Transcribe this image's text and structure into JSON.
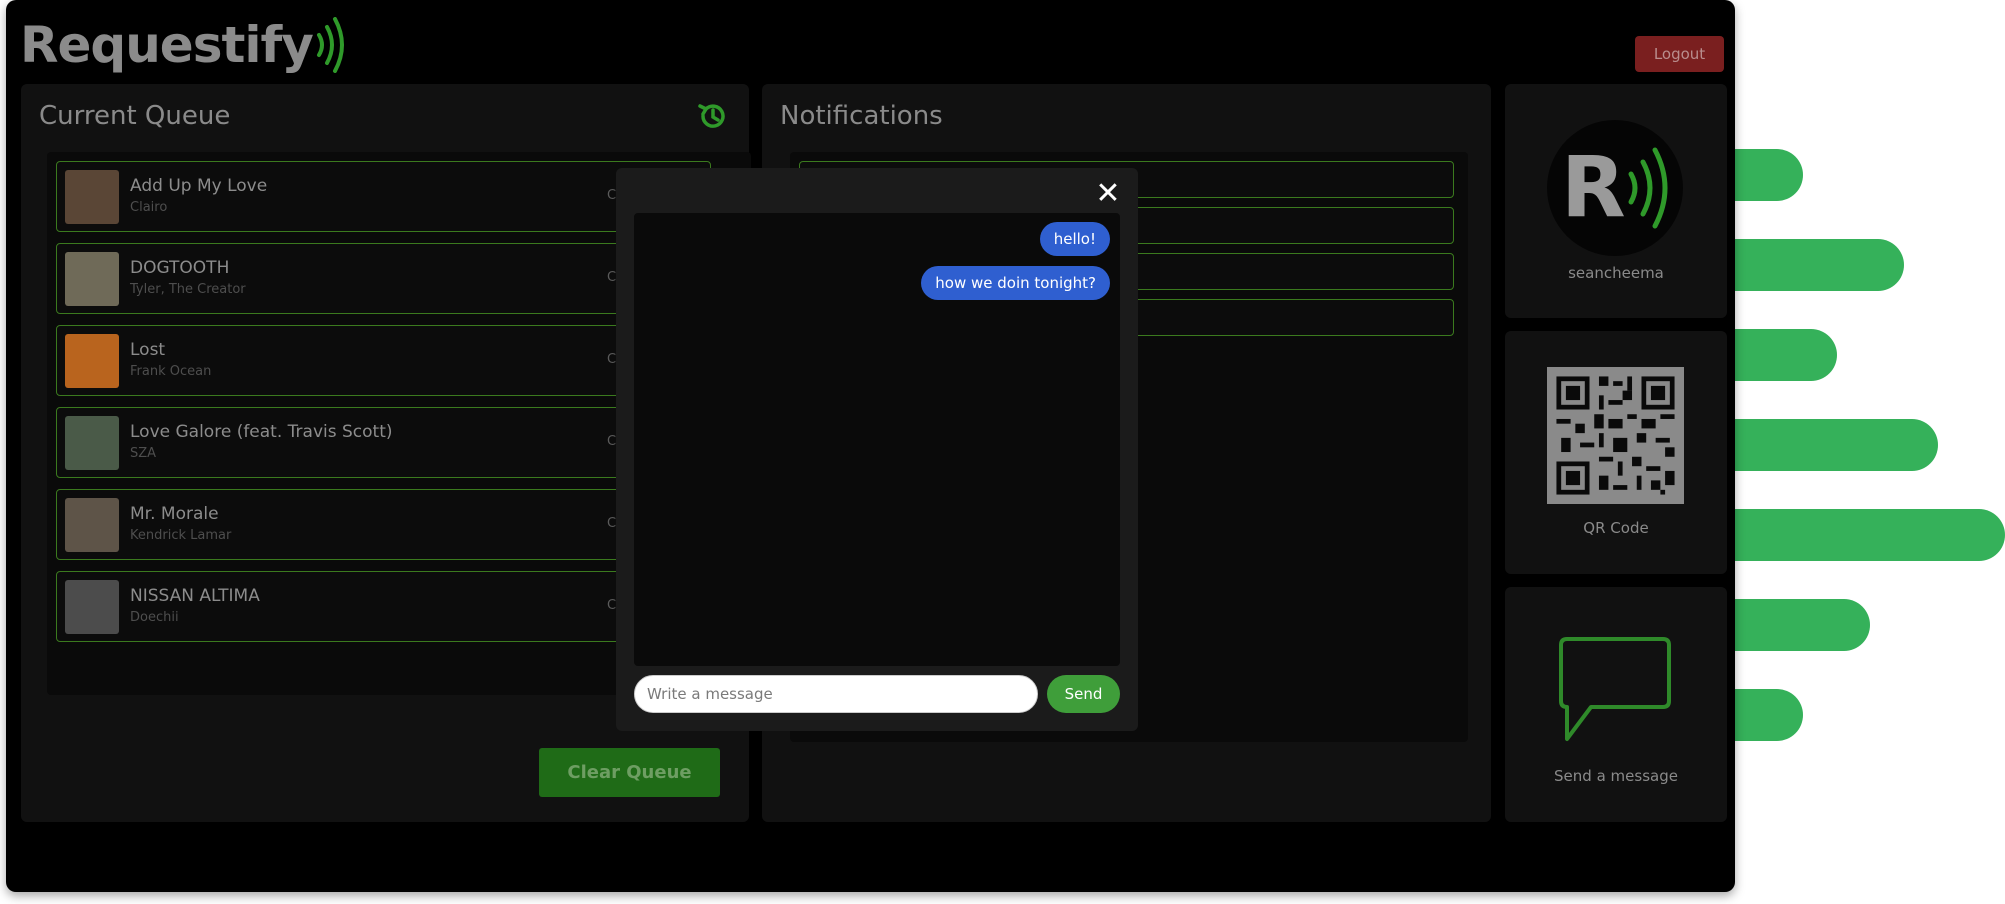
{
  "app": {
    "title": "Requestify"
  },
  "header": {
    "logout_label": "Logout"
  },
  "queue": {
    "title": "Current Queue",
    "songs": [
      {
        "title": "Add Up My Love",
        "artist": "Clairo",
        "extra": "C",
        "art_color": "#5a4636"
      },
      {
        "title": "DOGTOOTH",
        "artist": "Tyler, The Creator",
        "extra": "C",
        "art_color": "#6f6a58"
      },
      {
        "title": "Lost",
        "artist": "Frank Ocean",
        "extra": "C",
        "art_color": "#b9641e"
      },
      {
        "title": "Love Galore (feat. Travis Scott)",
        "artist": "SZA",
        "extra": "C",
        "art_color": "#4a5a48"
      },
      {
        "title": "Mr. Morale",
        "artist": "Kendrick Lamar",
        "extra": "C",
        "art_color": "#5e5448"
      },
      {
        "title": "NISSAN ALTIMA",
        "artist": "Doechii",
        "extra": "C",
        "art_color": "#4c4c4c"
      }
    ],
    "clear_label": "Clear Queue",
    "history_icon": "history-icon"
  },
  "notifications": {
    "title": "Notifications"
  },
  "profile": {
    "username": "seancheema",
    "avatar_letter": "R"
  },
  "qr": {
    "label": "QR Code"
  },
  "messaging": {
    "label": "Send a message"
  },
  "chat_modal": {
    "close_symbol": "✕",
    "messages": [
      "hello!",
      "how we doin tonight?"
    ],
    "input_placeholder": "Write a message",
    "send_label": "Send"
  },
  "colors": {
    "accent_green": "#35b15a",
    "border_green": "#3b7a1e",
    "bubble_blue": "#2f5fd0",
    "logout_red": "#7a1f1f"
  }
}
